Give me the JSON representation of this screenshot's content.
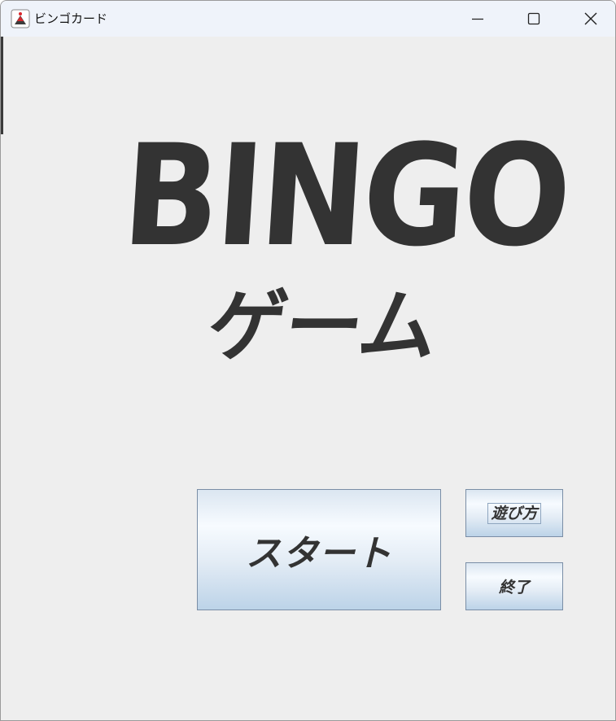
{
  "window": {
    "title": "ビンゴカード",
    "app_icon": "java-cup-icon",
    "controls": {
      "minimize": "minimize-icon",
      "maximize": "maximize-icon",
      "close": "close-icon"
    }
  },
  "logo": {
    "title": "BINGO",
    "subtitle": "ゲーム",
    "color": "#333333"
  },
  "buttons": {
    "start": "スタート",
    "how_to_play": "遊び方",
    "quit": "終了"
  },
  "colors": {
    "background": "#eeeeee",
    "titlebar": "#eff3fa",
    "button_border": "#7a8ea6",
    "button_gradient_bottom": "#bcd3e8"
  }
}
